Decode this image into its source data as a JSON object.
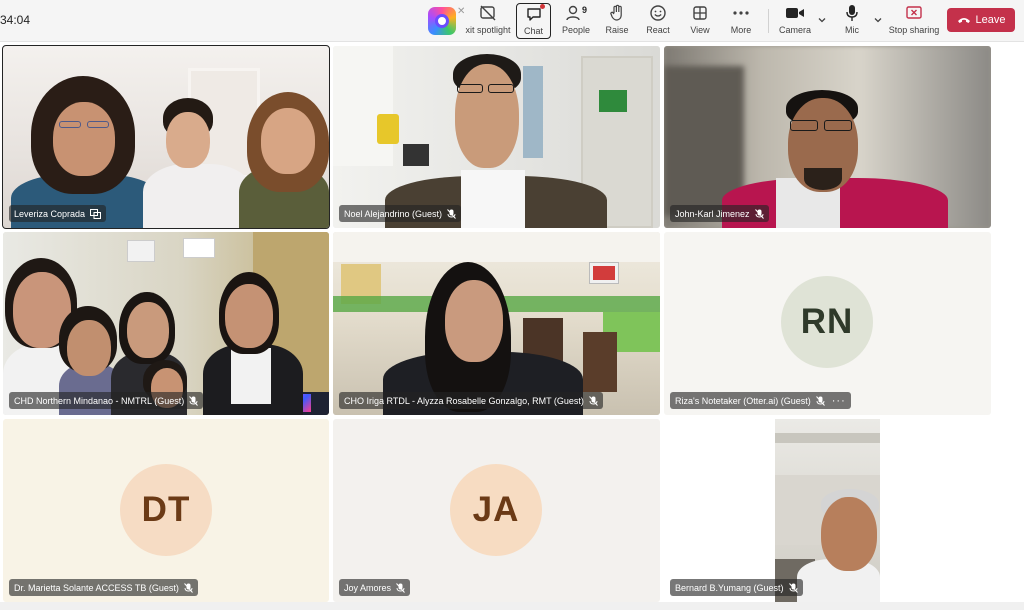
{
  "meeting": {
    "timer": "34:04"
  },
  "toolbar": {
    "exit_spotlight": "xit spotlight",
    "chat": "Chat",
    "people": "People",
    "people_count": "9",
    "raise": "Raise",
    "react": "React",
    "view": "View",
    "more": "More",
    "camera": "Camera",
    "mic": "Mic",
    "stop_sharing": "Stop sharing",
    "leave": "Leave"
  },
  "participants": [
    {
      "name": "Leveriza Coprada",
      "video": true
    },
    {
      "name": "Noel Alejandrino (Guest)",
      "video": true
    },
    {
      "name": "John-Karl Jimenez",
      "video": true
    },
    {
      "name": "CHD Northern Mindanao - NMTRL (Guest)",
      "video": true
    },
    {
      "name": "CHO Iriga RTDL - Alyzza Rosabelle Gonzalgo, RMT (Guest)",
      "video": true
    },
    {
      "name": "Riza's Notetaker (Otter.ai) (Guest)",
      "video": false,
      "initials": "RN"
    },
    {
      "name": "Dr. Marietta Solante ACCESS TB (Guest)",
      "video": false,
      "initials": "DT"
    },
    {
      "name": "Joy Amores",
      "video": false,
      "initials": "JA"
    },
    {
      "name": "Bernard B.Yumang (Guest)",
      "video": true
    }
  ],
  "colors": {
    "leave_button": "#c4314b",
    "avatar_rn_bg": "#dfe3d6",
    "avatar_rn_text": "#2f3a2a",
    "avatar_dt_bg": "#f6dcc4",
    "avatar_dt_text": "#6b3a16",
    "avatar_ja_bg": "#f7dcc2",
    "avatar_ja_text": "#6b3a16"
  },
  "icons": {
    "spotlight": "spotlight-off-icon",
    "chat": "chat-icon",
    "people": "people-icon",
    "raise": "hand-icon",
    "react": "smile-icon",
    "view": "grid-icon",
    "more": "more-icon",
    "camera": "video-camera-icon",
    "mic": "microphone-icon",
    "stop_sharing": "stop-share-icon",
    "leave": "phone-hangup-icon",
    "muted": "mic-off-icon"
  }
}
